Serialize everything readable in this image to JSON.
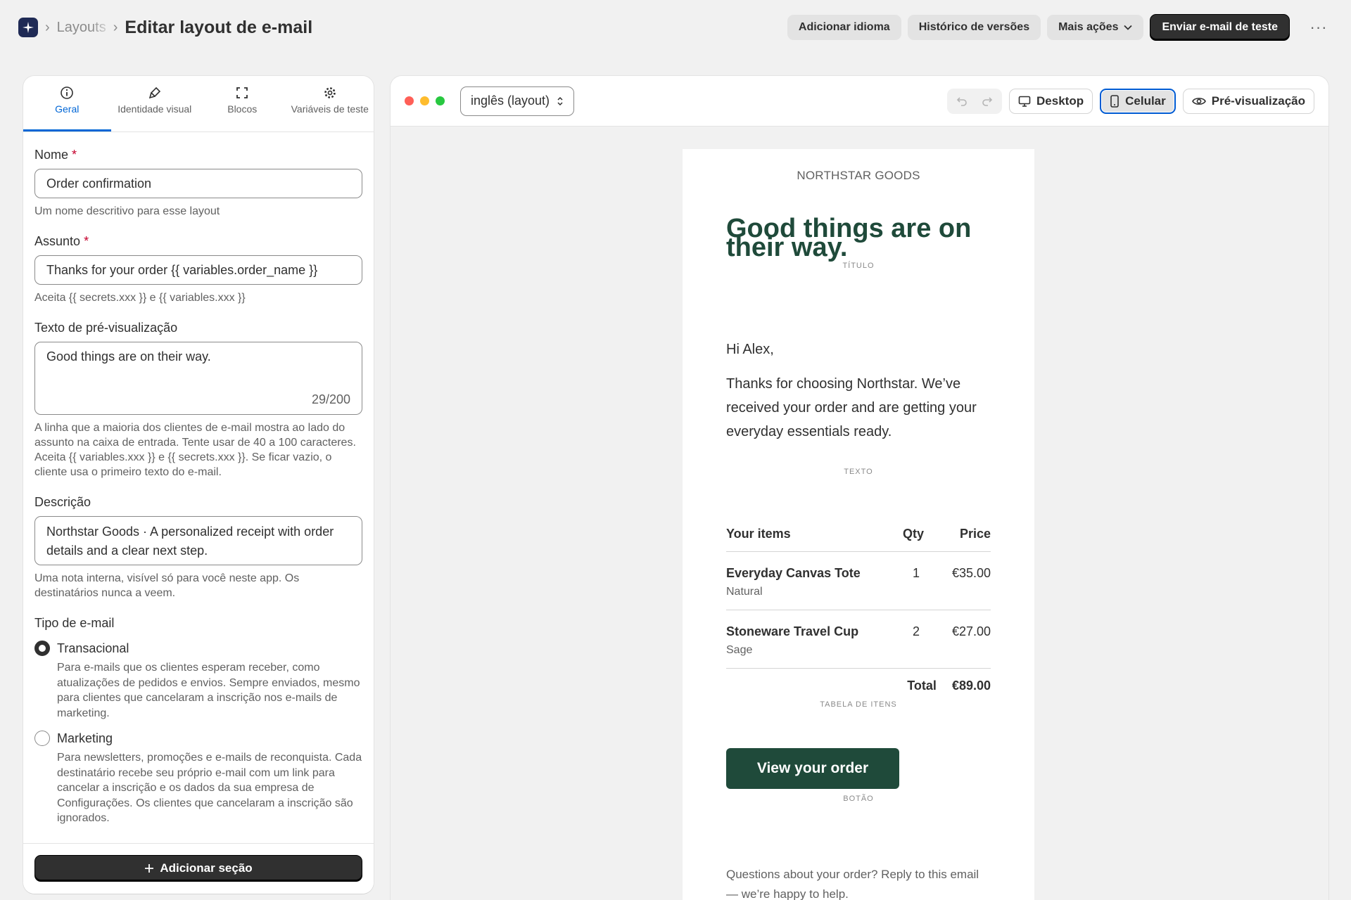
{
  "header": {
    "breadcrumb_parent": "Layouts",
    "title": "Editar layout de e-mail",
    "actions": {
      "add_language": "Adicionar idioma",
      "version_history": "Histórico de versões",
      "more_actions": "Mais ações",
      "send_test": "Enviar e-mail de teste"
    }
  },
  "tabs": [
    {
      "label": "Geral",
      "icon": "info-icon"
    },
    {
      "label": "Identidade visual",
      "icon": "paint-brush-icon"
    },
    {
      "label": "Blocos",
      "icon": "frame-icon"
    },
    {
      "label": "Variáveis de teste",
      "icon": "gear-icon"
    }
  ],
  "form": {
    "name_label": "Nome",
    "name_value": "Order confirmation",
    "name_help": "Um nome descritivo para esse layout",
    "subject_label": "Assunto",
    "subject_value": "Thanks for your order {{ variables.order_name }}",
    "subject_help": "Aceita {{ secrets.xxx }} e {{ variables.xxx }}",
    "preview_label": "Texto de pré-visualização",
    "preview_value": "Good things are on their way.",
    "preview_counter": "29/200",
    "preview_help": "A linha que a maioria dos clientes de e-mail mostra ao lado do assunto na caixa de entrada. Tente usar de 40 a 100 caracteres. Aceita {{ variables.xxx }} e {{ secrets.xxx }}. Se ficar vazio, o cliente usa o primeiro texto do e-mail.",
    "description_label": "Descrição",
    "description_value": "Northstar Goods · A personalized receipt with order details and a clear next step.",
    "description_help": "Uma nota interna, visível só para você neste app. Os destinatários nunca a veem.",
    "type_label": "Tipo de e-mail",
    "type_transactional": "Transacional",
    "type_transactional_help": "Para e-mails que os clientes esperam receber, como atualizações de pedidos e envios. Sempre enviados, mesmo para clientes que cancelaram a inscrição nos e-mails de marketing.",
    "type_marketing": "Marketing",
    "type_marketing_help": "Para newsletters, promoções e e-mails de reconquista. Cada destinatário recebe seu próprio e-mail com um link para cancelar a inscrição e os dados da sua empresa de Configurações. Os clientes que cancelaram a inscrição são ignorados.",
    "add_section": "Adicionar seção"
  },
  "toolbar": {
    "language": "inglês (layout)",
    "desktop": "Desktop",
    "mobile": "Celular",
    "preview": "Pré-visualização"
  },
  "email": {
    "brand": "NORTHSTAR GOODS",
    "title": "Good things are on their way.",
    "title_tag": "TÍTULO",
    "greeting": "Hi Alex,",
    "body": "Thanks for choosing Northstar. We’ve received your order and are getting your everyday essentials ready.",
    "text_tag": "TEXTO",
    "items_header": {
      "name": "Your items",
      "qty": "Qty",
      "price": "Price"
    },
    "items": [
      {
        "name": "Everyday Canvas Tote",
        "variant": "Natural",
        "qty": "1",
        "price": "€35.00"
      },
      {
        "name": "Stoneware Travel Cup",
        "variant": "Sage",
        "qty": "2",
        "price": "€27.00"
      }
    ],
    "total_label": "Total",
    "total_value": "€89.00",
    "items_tag": "TABELA DE ITENS",
    "cta": "View your order",
    "cta_tag": "BOTÃO",
    "footer": "Questions about your order? Reply to this email — we’re happy to help."
  },
  "colors": {
    "accent_blue": "#0066d6",
    "brand_green": "#1f4a3a",
    "primary_dark": "#303030"
  }
}
